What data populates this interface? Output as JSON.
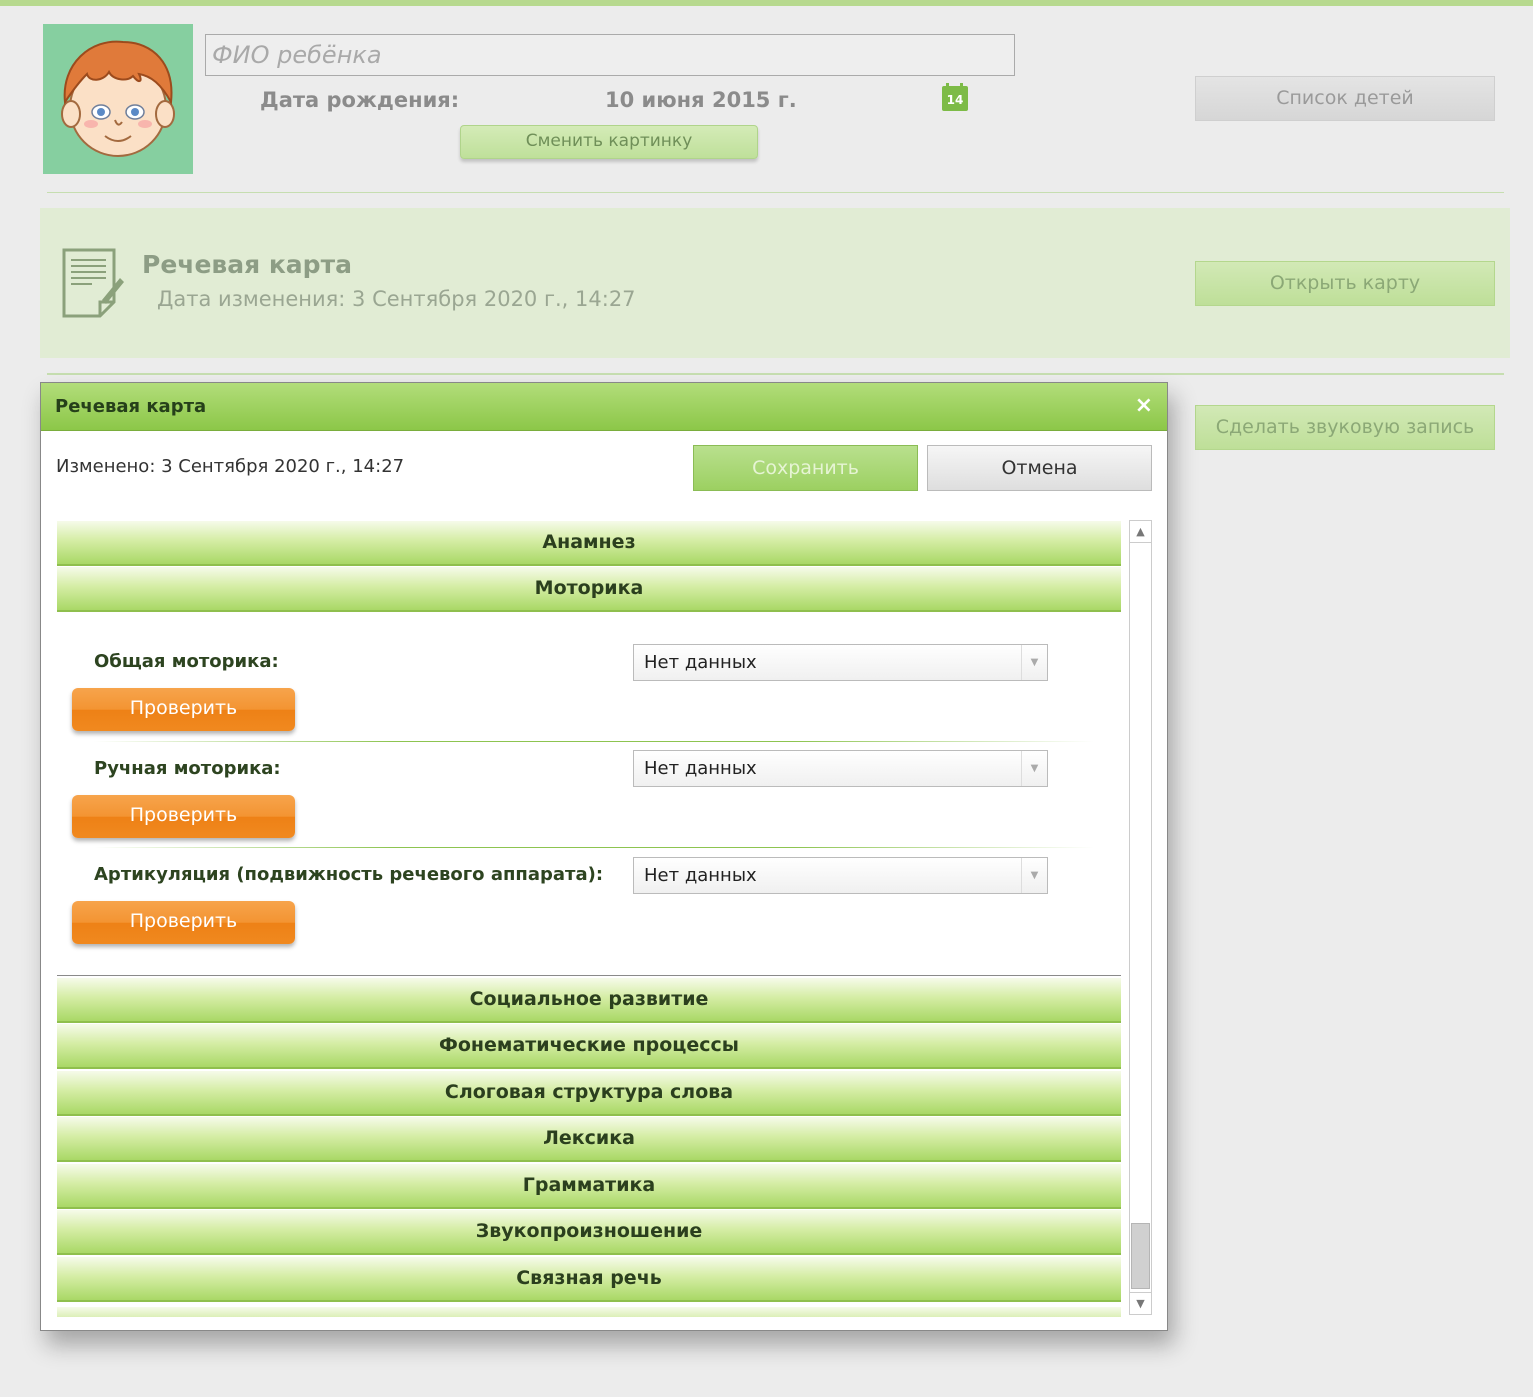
{
  "header": {
    "name_placeholder": "ФИО ребёнка",
    "birth_label": "Дата рождения:",
    "birth_value": "10 июня 2015 г.",
    "calendar_day": "14",
    "change_picture": "Сменить картинку",
    "children_list": "Список детей"
  },
  "card": {
    "title": "Речевая карта",
    "date_changed": "Дата изменения: 3 Сентября 2020 г., 14:27",
    "open_button": "Открыть карту"
  },
  "record_button": "Сделать звуковую запись",
  "dialog": {
    "title": "Речевая карта",
    "close": "×",
    "changed": "Изменено: 3 Сентября 2020 г., 14:27",
    "save": "Сохранить",
    "cancel": "Отмена",
    "sections": [
      "Анамнез",
      "Моторика",
      "Социальное развитие",
      "Фонематические процессы",
      "Слоговая структура слова",
      "Лексика",
      "Грамматика",
      "Звукопроизношение",
      "Связная речь"
    ],
    "motor_rows": [
      {
        "label": "Общая моторика:",
        "value": "Нет данных",
        "button": "Проверить"
      },
      {
        "label": "Ручная моторика:",
        "value": "Нет данных",
        "button": "Проверить"
      },
      {
        "label": "Артикуляция (подвижность речевого аппарата):",
        "value": "Нет данных",
        "button": "Проверить"
      }
    ]
  },
  "colors": {
    "accent_green": "#8cc748",
    "orange": "#f39432"
  }
}
